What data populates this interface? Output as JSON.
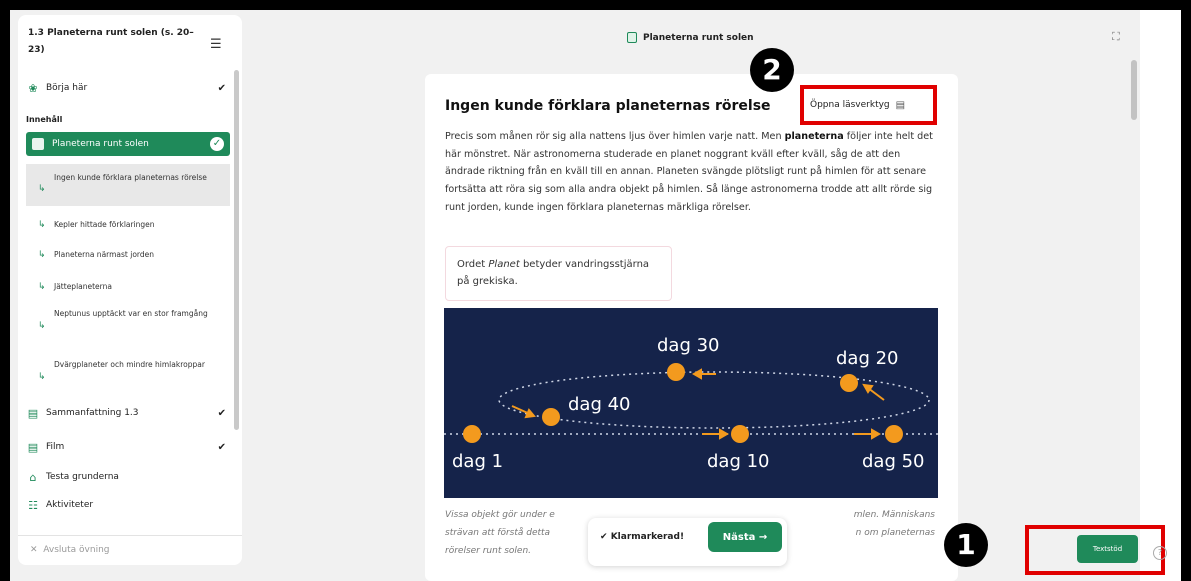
{
  "sidebar": {
    "title": "1.3 Planeterna runt solen (s. 20–23)",
    "start_label": "Börja här",
    "section_label": "Innehåll",
    "active_label": "Planeterna runt solen",
    "subitems": [
      "Ingen kunde förklara planeternas rörelse",
      "Kepler hittade förklaringen",
      "Planeterna närmast jorden",
      "Jätteplaneterna",
      "Neptunus upptäckt var en stor framgång",
      "Dvärgplaneter och mindre himlakroppar"
    ],
    "items": [
      {
        "label": "Sammanfattning 1.3",
        "checked": true
      },
      {
        "label": "Film",
        "checked": true
      },
      {
        "label": "Testa grunderna",
        "checked": false
      },
      {
        "label": "Aktiviteter",
        "checked": false
      }
    ],
    "footer": "Avsluta övning"
  },
  "topbar": {
    "title": "Planeterna runt solen"
  },
  "article": {
    "heading": "Ingen kunde förklara planeternas rörelse",
    "read_tool_label": "Öppna läsverktyg",
    "para_1": "Precis som månen rör sig alla nattens ljus över himlen varje natt. Men",
    "para_bold": "planeterna",
    "para_2": " följer inte helt det här mönstret. När astronomerna studerade en planet noggrant kväll efter kväll, såg de att den ändrade riktning från en kväll till en annan. Planeten svängde plötsligt runt på himlen för att senare fortsätta att röra sig som alla andra objekt på himlen. Så länge astronomerna trodde att allt rörde sig runt jorden, kunde ingen förklara planeternas märkliga rörelser.",
    "note_1": "Ordet ",
    "note_italic": "Planet",
    "note_2": " betyder vandringsstjärna på grekiska.",
    "figure_labels": [
      "dag 1",
      "dag 10",
      "dag 20",
      "dag 30",
      "dag 40",
      "dag 50"
    ],
    "caption_left_1": "Vissa objekt gör under e",
    "caption_left_2": "strävan att förstå detta",
    "caption_left_3": "rörelser runt solen.",
    "caption_right_1": "mlen. Människans",
    "caption_right_2": "n om planeternas"
  },
  "bottom": {
    "marked_label": "Klarmarkerad!",
    "next_label": "Nästa",
    "textstod_label": "Textstöd"
  },
  "badges": {
    "one": "1",
    "two": "2"
  },
  "colors": {
    "accent": "#1f8a5a",
    "highlight": "#e00000",
    "figure_bg": "#15234a",
    "planet": "#f39a1e"
  }
}
